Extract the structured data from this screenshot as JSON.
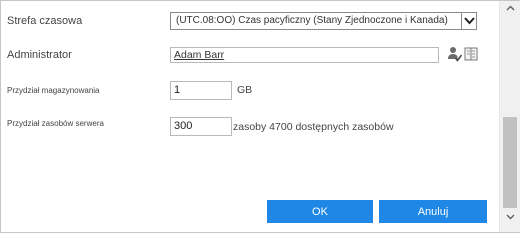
{
  "form": {
    "time_zone": {
      "label": "Strefa czasowa",
      "selected": "(UTC.08:OO) Czas pacyficzny (Stany Zjednoczone i Kanada)"
    },
    "administrator": {
      "label": "Administrator",
      "value": "Adam Barr"
    },
    "storage": {
      "label": "Przydział magazynowania",
      "value": "1",
      "unit": "GB"
    },
    "server_resources": {
      "label": "Przydział zasobów serwera",
      "value": "300",
      "unit": "zasoby 4700 dostępnych zasobów"
    }
  },
  "buttons": {
    "ok_label": "OK",
    "cancel_label": "Anuluj"
  },
  "colors": {
    "button_bg": "#1f87e5",
    "label_text": "#444444",
    "scroll_thumb": "#c1c1c1"
  },
  "icons": {
    "tz_dropdown": "chevron-down-icon",
    "check_names": "person-check-icon",
    "browse": "address-book-icon",
    "scroll_up": "chevron-up-icon",
    "scroll_down": "chevron-down-icon"
  }
}
